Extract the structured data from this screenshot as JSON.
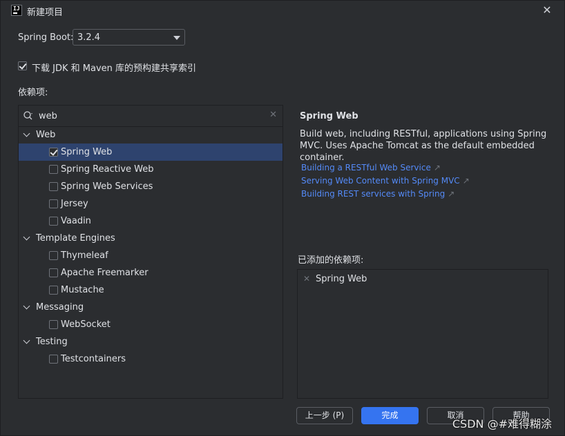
{
  "window": {
    "title": "新建项目"
  },
  "spring_boot": {
    "label": "Spring Boot:",
    "selected": "3.2.4"
  },
  "download_option": {
    "label": "下载 JDK 和 Maven 库的预构建共享索引",
    "checked": true
  },
  "dependencies_label": "依赖项:",
  "search": {
    "value": "web"
  },
  "tree": [
    {
      "type": "group",
      "label": "Web"
    },
    {
      "type": "item",
      "label": "Spring Web",
      "checked": true,
      "selected": true
    },
    {
      "type": "item",
      "label": "Spring Reactive Web",
      "checked": false
    },
    {
      "type": "item",
      "label": "Spring Web Services",
      "checked": false
    },
    {
      "type": "item",
      "label": "Jersey",
      "checked": false
    },
    {
      "type": "item",
      "label": "Vaadin",
      "checked": false
    },
    {
      "type": "group",
      "label": "Template Engines"
    },
    {
      "type": "item",
      "label": "Thymeleaf",
      "checked": false
    },
    {
      "type": "item",
      "label": "Apache Freemarker",
      "checked": false
    },
    {
      "type": "item",
      "label": "Mustache",
      "checked": false
    },
    {
      "type": "group",
      "label": "Messaging"
    },
    {
      "type": "item",
      "label": "WebSocket",
      "checked": false
    },
    {
      "type": "group",
      "label": "Testing"
    },
    {
      "type": "item",
      "label": "Testcontainers",
      "checked": false
    }
  ],
  "detail": {
    "title": "Spring Web",
    "description": "Build web, including RESTful, applications using Spring MVC. Uses Apache Tomcat as the default embedded container.",
    "links": [
      "Building a RESTful Web Service",
      "Serving Web Content with Spring MVC",
      "Building REST services with Spring"
    ]
  },
  "added": {
    "label": "已添加的依赖项:",
    "items": [
      "Spring Web"
    ]
  },
  "buttons": {
    "prev": "上一步 (P)",
    "finish": "完成",
    "cancel": "取消",
    "help": "帮助"
  },
  "watermark": "CSDN @#难得糊涂",
  "colors": {
    "accent": "#3574f0",
    "selection": "#2e436e",
    "link": "#548af7",
    "background": "#2b2d30"
  }
}
